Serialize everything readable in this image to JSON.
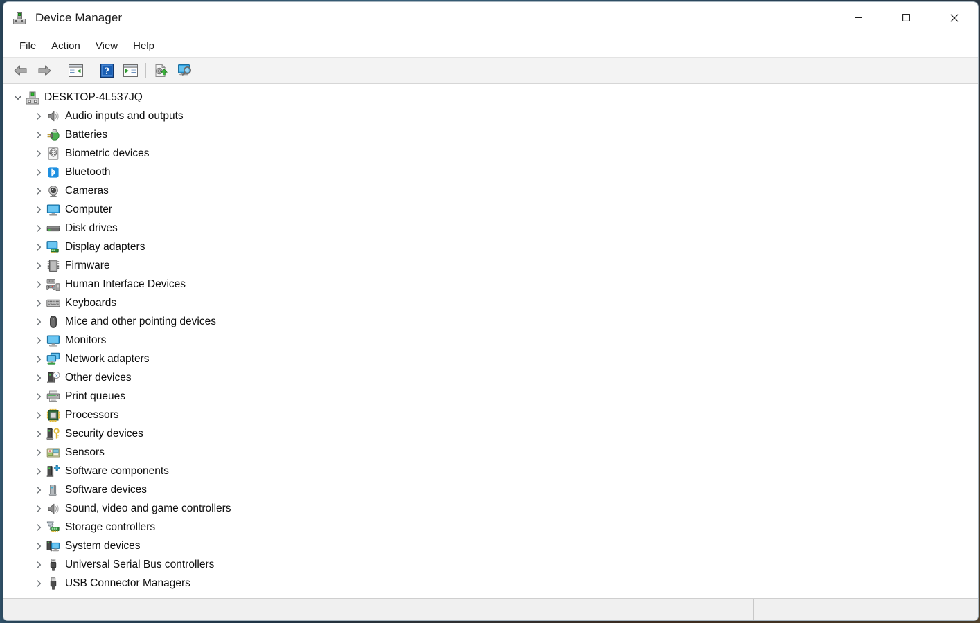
{
  "window": {
    "title": "Device Manager",
    "app_icon": "device-manager-icon",
    "controls": [
      {
        "name": "minimize",
        "glyph": "minimize-icon"
      },
      {
        "name": "maximize",
        "glyph": "maximize-icon"
      },
      {
        "name": "close",
        "glyph": "close-icon"
      }
    ]
  },
  "menubar": {
    "items": [
      {
        "label": "File"
      },
      {
        "label": "Action"
      },
      {
        "label": "View"
      },
      {
        "label": "Help"
      }
    ]
  },
  "toolbar": {
    "buttons": [
      {
        "name": "back-button",
        "icon": "back-arrow-icon",
        "tooltip": "Back"
      },
      {
        "name": "forward-button",
        "icon": "forward-arrow-icon",
        "tooltip": "Forward"
      },
      {
        "name": "show-hide-console-tree-button",
        "icon": "console-tree-icon",
        "tooltip": "Show/Hide Console Tree"
      },
      {
        "name": "help-button",
        "icon": "help-question-icon",
        "tooltip": "Help"
      },
      {
        "name": "properties-button",
        "icon": "properties-icon",
        "tooltip": "Properties"
      },
      {
        "name": "update-driver-button",
        "icon": "update-driver-icon",
        "tooltip": "Update driver"
      },
      {
        "name": "scan-hardware-changes-button",
        "icon": "scan-hardware-icon",
        "tooltip": "Scan for hardware changes"
      }
    ]
  },
  "tree": {
    "root": {
      "label": "DESKTOP-4L537JQ",
      "icon": "computer-root-icon",
      "expanded": true
    },
    "nodes": [
      {
        "label": "Audio inputs and outputs",
        "icon": "speaker-icon",
        "expanded": false
      },
      {
        "label": "Batteries",
        "icon": "battery-icon",
        "expanded": false
      },
      {
        "label": "Biometric devices",
        "icon": "fingerprint-icon",
        "expanded": false
      },
      {
        "label": "Bluetooth",
        "icon": "bluetooth-icon",
        "expanded": false
      },
      {
        "label": "Cameras",
        "icon": "camera-icon",
        "expanded": false
      },
      {
        "label": "Computer",
        "icon": "monitor-icon",
        "expanded": false
      },
      {
        "label": "Disk drives",
        "icon": "disk-drive-icon",
        "expanded": false
      },
      {
        "label": "Display adapters",
        "icon": "display-adapter-icon",
        "expanded": false
      },
      {
        "label": "Firmware",
        "icon": "chip-module-icon",
        "expanded": false
      },
      {
        "label": "Human Interface Devices",
        "icon": "hid-gamepad-icon",
        "expanded": false
      },
      {
        "label": "Keyboards",
        "icon": "keyboard-icon",
        "expanded": false
      },
      {
        "label": "Mice and other pointing devices",
        "icon": "mouse-icon",
        "expanded": false
      },
      {
        "label": "Monitors",
        "icon": "monitor-icon",
        "expanded": false
      },
      {
        "label": "Network adapters",
        "icon": "network-adapter-icon",
        "expanded": false
      },
      {
        "label": "Other devices",
        "icon": "unknown-device-icon",
        "expanded": false
      },
      {
        "label": "Print queues",
        "icon": "printer-icon",
        "expanded": false
      },
      {
        "label": "Processors",
        "icon": "processor-icon",
        "expanded": false
      },
      {
        "label": "Security devices",
        "icon": "security-key-icon",
        "expanded": false
      },
      {
        "label": "Sensors",
        "icon": "sensors-icon",
        "expanded": false
      },
      {
        "label": "Software components",
        "icon": "software-component-icon",
        "expanded": false
      },
      {
        "label": "Software devices",
        "icon": "software-device-icon",
        "expanded": false
      },
      {
        "label": "Sound, video and game controllers",
        "icon": "speaker-icon",
        "expanded": false
      },
      {
        "label": "Storage controllers",
        "icon": "storage-controller-icon",
        "expanded": false
      },
      {
        "label": "System devices",
        "icon": "system-device-icon",
        "expanded": false
      },
      {
        "label": "Universal Serial Bus controllers",
        "icon": "usb-icon",
        "expanded": false
      },
      {
        "label": "USB Connector Managers",
        "icon": "usb-icon",
        "expanded": false
      }
    ]
  },
  "statusbar": {
    "panels": [
      "",
      "",
      ""
    ]
  },
  "colors": {
    "window_bg": "#ffffff",
    "toolbar_bg": "#f3f3f3",
    "statusbar_bg": "#f0f0f0",
    "text": "#0d0d0d",
    "accent_blue": "#0a8fdc",
    "close_hover": "#c42b1c"
  }
}
